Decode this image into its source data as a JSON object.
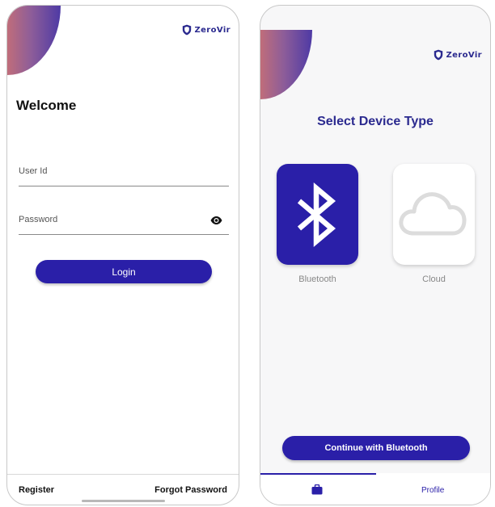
{
  "login_screen": {
    "brand": "ZeroVir",
    "heading": "Welcome",
    "user_id": {
      "placeholder": "User Id",
      "value": ""
    },
    "password": {
      "placeholder": "Password",
      "value": ""
    },
    "login_label": "Login",
    "register_label": "Register",
    "forgot_password_label": "Forgot Password",
    "icons": {
      "password_toggle": "eye-icon",
      "brand": "shield-icon"
    }
  },
  "device_screen": {
    "brand": "ZeroVir",
    "heading": "Select Device Type",
    "options": [
      {
        "label": "Bluetooth",
        "icon": "bluetooth-icon",
        "selected": true
      },
      {
        "label": "Cloud",
        "icon": "cloud-icon",
        "selected": false
      }
    ],
    "continue_label": "Continue with Bluetooth",
    "tabs": [
      {
        "label": "",
        "icon": "briefcase-icon",
        "active": true
      },
      {
        "label": "Profile",
        "active": false
      }
    ]
  },
  "colors": {
    "primary": "#2a1fa8",
    "brand_text": "#2b2a8f",
    "gradient_start": "#c06d7a",
    "gradient_end": "#4e3aa5",
    "muted_label": "#888888"
  }
}
